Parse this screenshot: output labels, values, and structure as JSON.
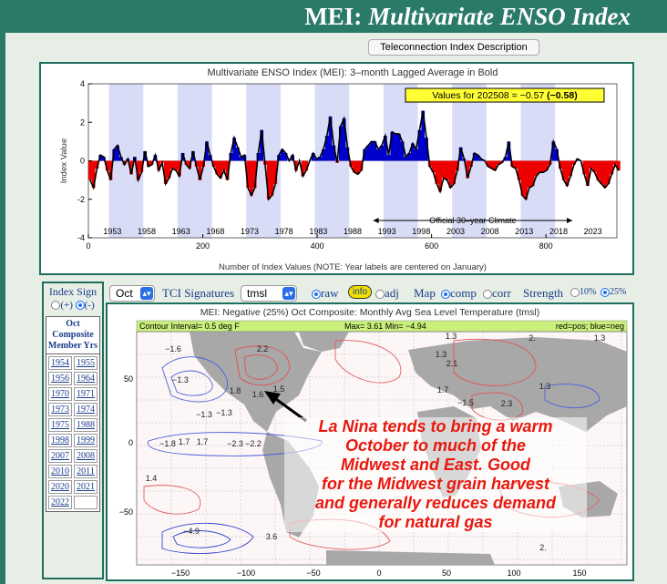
{
  "title": {
    "main": "MEI:",
    "italic": "Multivariate ENSO Index"
  },
  "teleconnection_button": "Teleconnection Index Description",
  "chart_data": {
    "type": "area",
    "title": "Multivariate ENSO Index (MEI): 3–month Lagged Average in Bold",
    "xlabel": "Number of Index Values (NOTE: Year labels are centered on January)",
    "ylabel": "Index Value",
    "xlim": [
      0,
      924
    ],
    "ylim": [
      -4,
      4
    ],
    "x_ticks": [
      0,
      200,
      400,
      600,
      800
    ],
    "y_ticks": [
      -4,
      -2,
      0,
      2,
      4
    ],
    "year_labels": [
      "1953",
      "1958",
      "1963",
      "1968",
      "1973",
      "1978",
      "1983",
      "1988",
      "1993",
      "1998",
      "2003",
      "2008",
      "2013",
      "2018",
      "2023"
    ],
    "shaded_bands_start_years": [
      1953,
      1963,
      1973,
      1983,
      1993,
      2003,
      2013
    ],
    "value_box": {
      "prefix": "Values for 202508 = −0.57",
      "bold": "(−0.58)"
    },
    "climate_label": "Official 30–year Climate",
    "climate_range_years": [
      1991,
      2020
    ],
    "start_year": 1950,
    "positive_color": "#0000cc",
    "negative_color": "#ee0000",
    "series_step": 6,
    "values": [
      -1.0,
      -1.4,
      -0.4,
      0.3,
      0.2,
      -0.5,
      -1.0,
      0.6,
      0.8,
      0.2,
      -0.2,
      0.1,
      -0.7,
      0.2,
      -1.0,
      -0.6,
      0.5,
      -0.3,
      -0.2,
      0.3,
      -0.5,
      -0.1,
      -1.2,
      -0.9,
      -0.4,
      -0.5,
      -0.8,
      0.4,
      -0.2,
      -0.4,
      0.5,
      -0.3,
      -1.0,
      -0.3,
      1.0,
      0.3,
      -0.3,
      -0.7,
      -0.9,
      -0.5,
      -1.0,
      0.4,
      1.2,
      0.7,
      0.2,
      0.3,
      -1.4,
      -1.8,
      -1.4,
      0.4,
      1.6,
      -0.2,
      -2.0,
      -1.8,
      -1.2,
      0.3,
      0.6,
      0.4,
      0.0,
      0.3,
      -0.5,
      0.0,
      -0.8,
      -0.5,
      0.0,
      0.4,
      0.1,
      0.2,
      0.6,
      1.3,
      2.3,
      0.8,
      -0.1,
      1.8,
      2.2,
      0.7,
      -0.3,
      -0.6,
      -0.7,
      -0.5,
      0.6,
      0.8,
      1.0,
      1.0,
      0.6,
      0.8,
      1.3,
      0.3,
      1.5,
      1.4,
      1.4,
      1.0,
      0.2,
      0.4,
      0.9,
      0.6,
      1.6,
      2.6,
      1.2,
      -0.3,
      -0.6,
      -1.2,
      -1.6,
      -0.9,
      -1.0,
      -1.4,
      -1.2,
      -0.5,
      0.7,
      0.1,
      -0.9,
      -0.3,
      0.4,
      0.3,
      0.1,
      0.0,
      -0.3,
      -0.4,
      -0.5,
      -0.2,
      -0.1,
      0.2,
      1.0,
      -0.3,
      -0.4,
      -1.0,
      -1.8,
      -2.0,
      -1.4,
      -1.3,
      -0.8,
      -0.6,
      -0.6,
      -0.5,
      -0.2,
      1.0,
      0.6,
      -0.4,
      -1.0,
      -1.3,
      -0.8,
      -0.2,
      0.1,
      0.0,
      -0.7,
      -1.3,
      -0.4,
      -0.6,
      -1.0,
      -1.2,
      -1.4,
      -1.2,
      -0.7,
      -0.2,
      -0.5
    ]
  },
  "left_panel": {
    "title": "Index Sign",
    "radio_plus": "(+)",
    "radio_minus": "(-)",
    "composite_head": [
      "Oct",
      "Composite",
      "Member Yrs"
    ],
    "years": [
      "1954",
      "1955",
      "1956",
      "1964",
      "1970",
      "1971",
      "1973",
      "1974",
      "1975",
      "1988",
      "1998",
      "1999",
      "2007",
      "2008",
      "2010",
      "2011",
      "2020",
      "2021",
      "2022",
      ""
    ]
  },
  "controls": {
    "month": "Oct",
    "tci_label": "TCI Signatures",
    "variable": "tmsl",
    "raw": "raw",
    "info": "info",
    "adj": "adj",
    "map_label": "Map",
    "comp": "comp",
    "corr": "corr",
    "strength_label": "Strength",
    "s10": "10%",
    "s25": "25%"
  },
  "map": {
    "title": "MEI: Negative (25%) Oct Composite: Monthly Avg Sea Level Temperature (tmsl)",
    "contour_interval": "Contour Interval= 0.5 deg F",
    "maxmin": "Max= 3.61  Min= −4.94",
    "legend": "red=pos; blue=neg",
    "lat_labels": [
      "50",
      "0",
      "−50"
    ],
    "lon_labels": [
      "−150",
      "−100",
      "−50",
      "0",
      "50",
      "100",
      "150"
    ],
    "values": [
      "−1.6",
      "2.2",
      "−1.3",
      "1.8",
      "1.6",
      "1.5",
      "−1.3",
      "−1.3",
      "−1.8",
      "1.7",
      "1.7",
      "−2.3",
      "−2.2",
      "1.4",
      "−4.9",
      "3.6",
      "1.3",
      "2.1",
      "1.7",
      "1.3",
      "−1.5",
      "2.3",
      "1.3",
      "2.",
      "1.3",
      "2."
    ]
  },
  "annotation": [
    "La Nina tends to bring a warm",
    "October to much of the",
    "Midwest and East. Good",
    "for the Midwest grain harvest",
    "and generally reduces demand",
    "for natural gas"
  ]
}
